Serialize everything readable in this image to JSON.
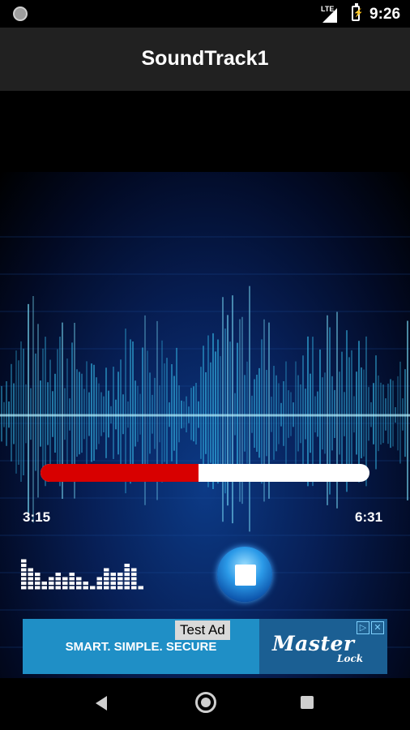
{
  "status_bar": {
    "network_label": "LTE",
    "time": "9:26",
    "icons": [
      "notification-dot-icon",
      "signal-icon",
      "battery-charging-icon"
    ]
  },
  "app_bar": {
    "title": "SoundTrack1"
  },
  "player": {
    "progress_fraction": 0.48,
    "elapsed": "3:15",
    "duration": "6:31",
    "stop_icon": "stop-icon",
    "equalizer_icon": "equalizer-icon",
    "colors": {
      "progress_played": "#d80000",
      "progress_remaining": "#ffffff",
      "button": "#2b9ae8"
    }
  },
  "ad": {
    "badge": "Test Ad",
    "tagline": "SMART. SIMPLE. SECURE",
    "brand": "Master",
    "brand_sub": "Lock",
    "choices_icon": "ad-choices-icon"
  },
  "nav_bar": {
    "icons": [
      "back-icon",
      "home-icon",
      "recents-icon"
    ]
  }
}
